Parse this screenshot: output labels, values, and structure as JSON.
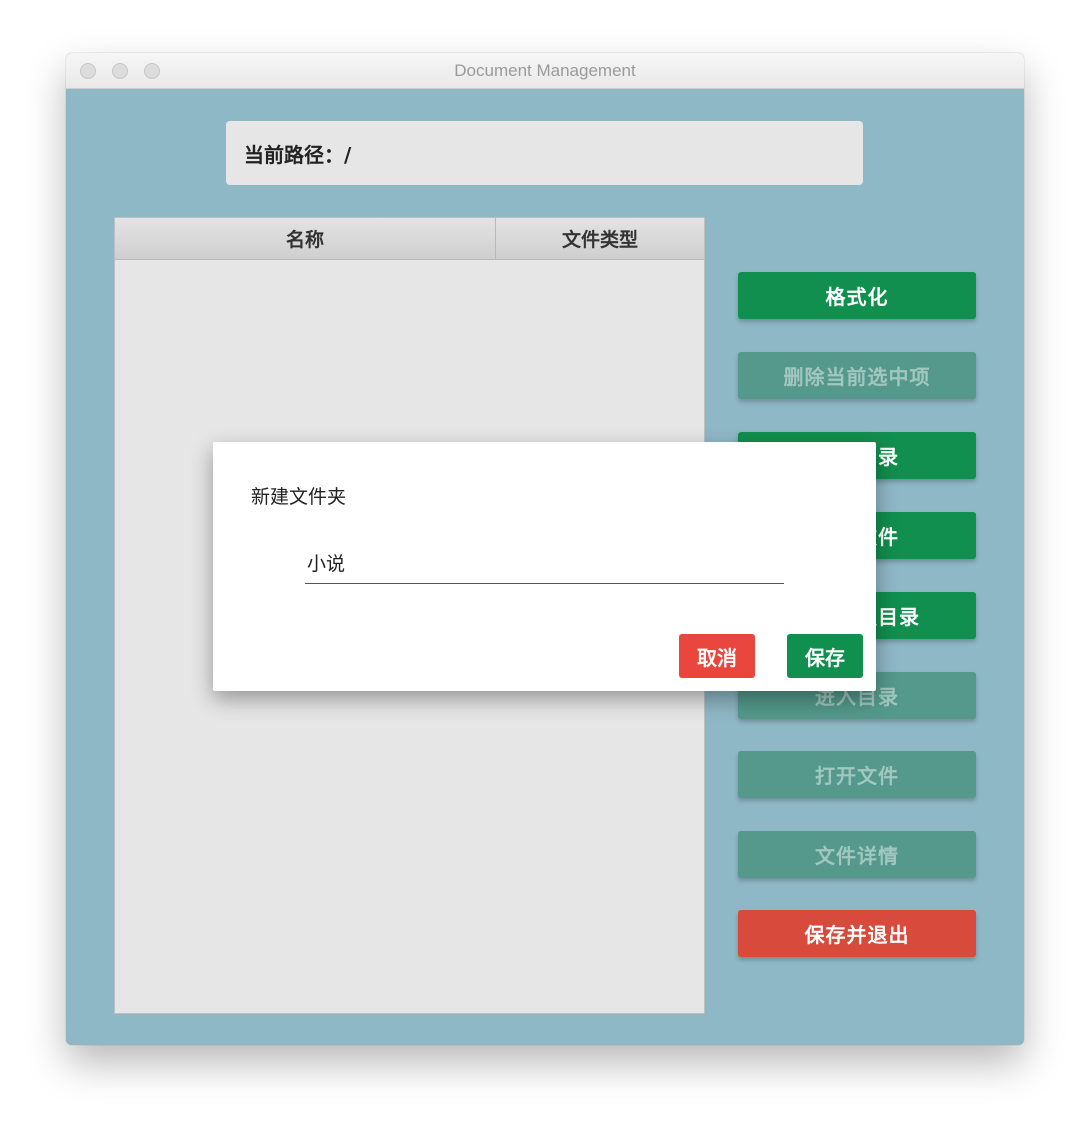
{
  "window": {
    "title": "Document Management"
  },
  "path": {
    "label": "当前路径：/"
  },
  "table": {
    "columns": [
      "名称",
      "文件类型"
    ],
    "rows": []
  },
  "sidebar": {
    "buttons": [
      {
        "label": "格式化",
        "state": "enabled",
        "color": "#118f4e"
      },
      {
        "label": "删除当前选中项",
        "state": "disabled",
        "color": "#54998b"
      },
      {
        "label": "新建目录",
        "state": "enabled",
        "color": "#118f4e"
      },
      {
        "label": "新建文件",
        "state": "enabled",
        "color": "#118f4e"
      },
      {
        "label": "返回上级目录",
        "state": "enabled",
        "color": "#118f4e"
      },
      {
        "label": "进入目录",
        "state": "disabled",
        "color": "#54998b"
      },
      {
        "label": "打开文件",
        "state": "disabled",
        "color": "#54998b"
      },
      {
        "label": "文件详情",
        "state": "disabled",
        "color": "#54998b"
      },
      {
        "label": "保存并退出",
        "state": "enabled",
        "color": "#d84a3c"
      }
    ]
  },
  "dialog": {
    "title": "新建文件夹",
    "input_value": "小说",
    "cancel_label": "取消",
    "save_label": "保存"
  },
  "colors": {
    "window_bg": "#8fb8c6",
    "green": "#118f4e",
    "green_disabled": "#54998b",
    "red": "#d84a3c"
  }
}
